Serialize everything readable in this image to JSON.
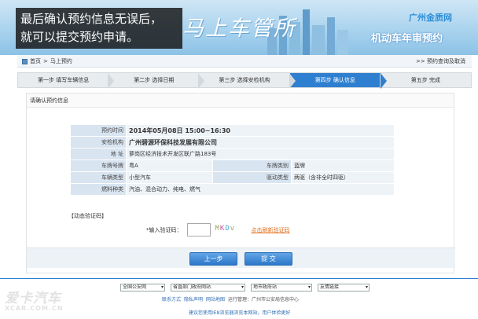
{
  "banner": {
    "overlay_line1": "最后确认预约信息无误后，",
    "overlay_line2": "就可以提交预约申请。",
    "brush_text": "马上车管所",
    "org": "广州金质网",
    "system": "机动车年审预约"
  },
  "breadcrumb": {
    "home": "首页",
    "separator": " > ",
    "current": "马上预约",
    "right_link": ">> 预约查询及取消"
  },
  "steps": [
    {
      "label": "第一步  填写车辆信息",
      "active": false
    },
    {
      "label": "第二步  选择日期",
      "active": false
    },
    {
      "label": "第三步  选择安检机构",
      "active": false
    },
    {
      "label": "第四步  确认信息",
      "active": true
    },
    {
      "label": "第五步  完成",
      "active": false
    }
  ],
  "section_title": "请确认预约信息",
  "info": {
    "time_label": "预约时间",
    "time_value": "2014年05月08日  15:00~16:30",
    "agency_label": "安检机构",
    "agency_value": "广州碧源环保科技发展有限公司",
    "address_label": "地    址",
    "address_value": "萝岗区经济技术开发区联广路183号",
    "plate_label": "车牌号牌",
    "plate_value": "粤A",
    "plate_type_label": "车牌类别",
    "plate_type_value": "蓝牌",
    "vehicle_type_label": "车辆类型",
    "vehicle_type_value": "小型汽车",
    "drive_label": "驱动类型",
    "drive_value": "两驱（含非全时四驱）",
    "fuel_label": "燃料种类",
    "fuel_value": "汽油、混合动力、纯电、燃气"
  },
  "verify": {
    "header": "【动态验证码】",
    "label": "*输入验证码：",
    "captcha_chars": [
      "M",
      "K",
      "D",
      "v"
    ],
    "refresh": "点击刷新验证码"
  },
  "buttons": {
    "prev": "上一步",
    "submit": "提  交"
  },
  "footer": {
    "selects": [
      "全国公安网",
      "省直部门政府网站",
      "地市政府站",
      "友情链接"
    ],
    "links": [
      "联系方式",
      "隐私声明",
      "网站地图",
      "运行管理：广州市公安局信息中心"
    ],
    "tip": "建议您使用IE8浏览器浏览本网站，用户体验更好"
  },
  "watermark": {
    "main": "爱卡汽车",
    "sub": "XCAR.COM.CN"
  }
}
